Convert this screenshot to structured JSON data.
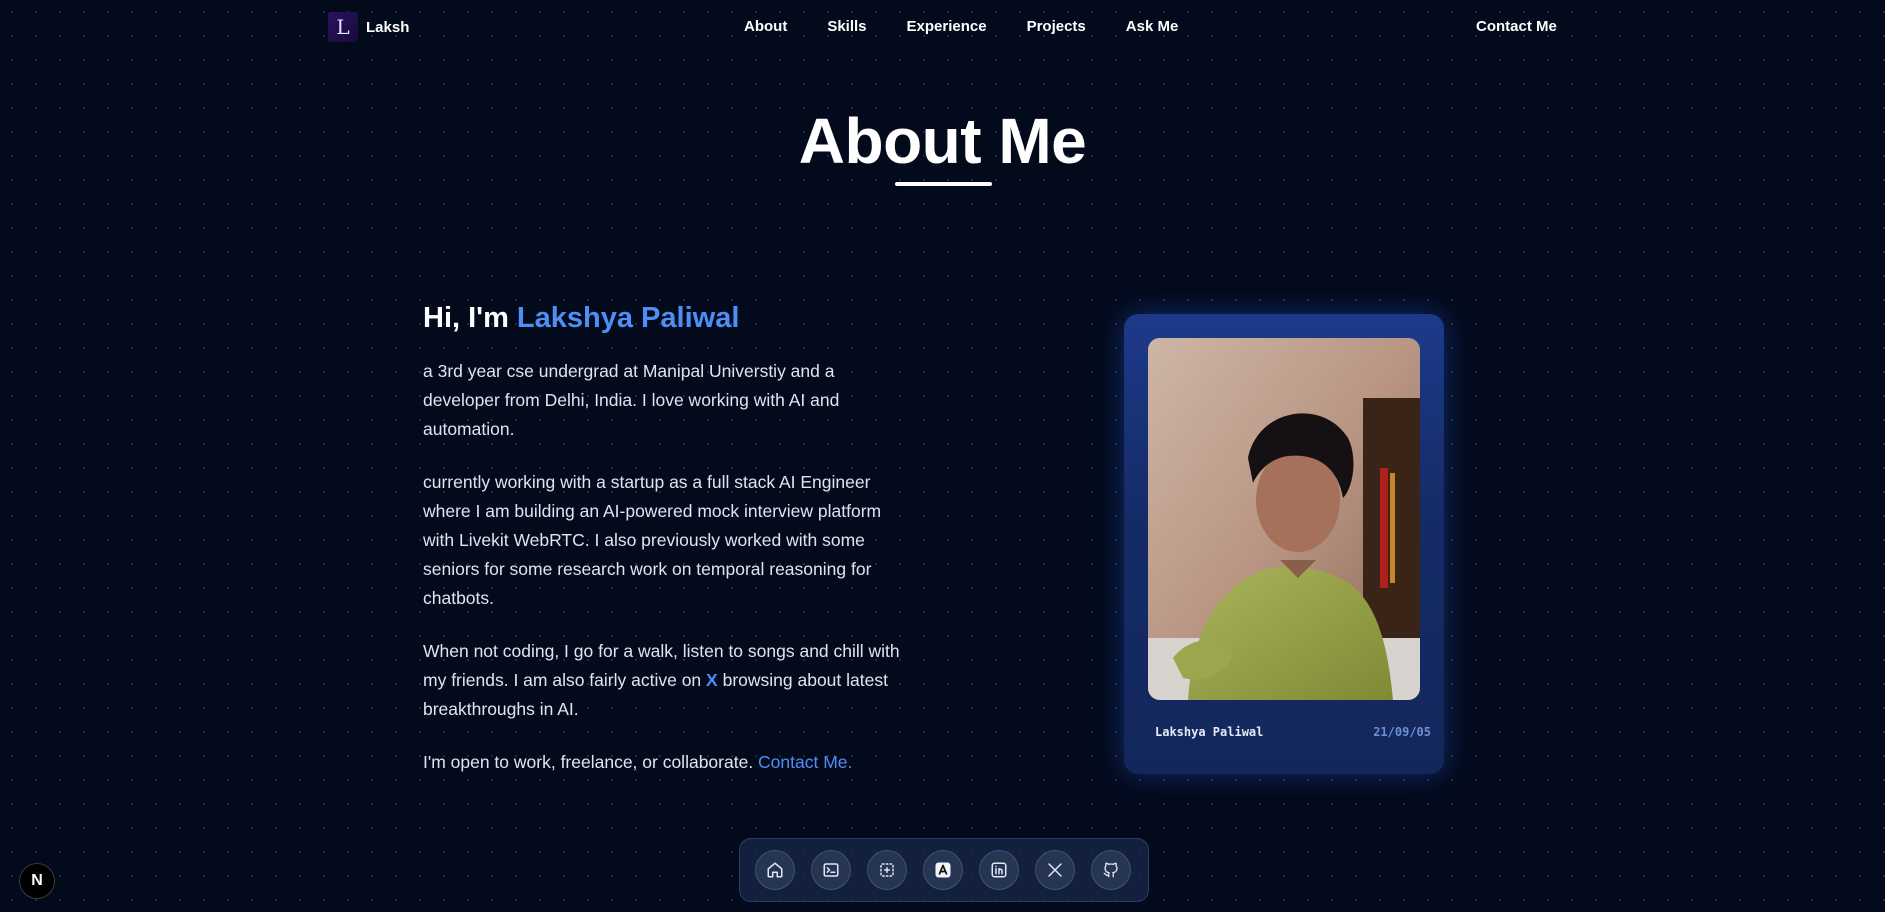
{
  "nav": {
    "logo_letter": "L",
    "logo_text": "Laksh",
    "links": [
      {
        "label": "About"
      },
      {
        "label": "Skills"
      },
      {
        "label": "Experience"
      },
      {
        "label": "Projects"
      },
      {
        "label": "Ask Me"
      }
    ],
    "contact_label": "Contact Me"
  },
  "page": {
    "title": "About Me"
  },
  "intro": {
    "greeting_prefix": "Hi, I'm ",
    "name": "Lakshya Paliwal",
    "para1": "a 3rd year cse undergrad at Manipal Universtiy and a developer from Delhi, India. I love working with AI and automation.",
    "para2": "currently working with a startup as a full stack AI Engineer where I am building an AI-powered mock interview platform with Livekit WebRTC. I also previously worked with some seniors for some research work on temporal reasoning for chatbots.",
    "para3_before": "When not coding, I go for a walk, listen to songs and chill with my friends. I am also fairly active on ",
    "para3_link": "X",
    "para3_after": " browsing about latest breakthroughs in AI.",
    "para4_before": "I'm open to work, freelance, or collaborate. ",
    "para4_link": "Contact Me."
  },
  "card": {
    "name": "Lakshya Paliwal",
    "date": "21/09/05"
  },
  "dock": {
    "items": [
      {
        "icon": "home-icon"
      },
      {
        "icon": "terminal-icon"
      },
      {
        "icon": "focus-icon"
      },
      {
        "icon": "blog-icon"
      },
      {
        "icon": "linkedin-icon"
      },
      {
        "icon": "x-icon"
      },
      {
        "icon": "github-icon"
      }
    ]
  },
  "badge": {
    "letter": "N"
  },
  "colors": {
    "background": "#030a1c",
    "accent": "#4f8ef7",
    "card": "#1d3a8a"
  }
}
